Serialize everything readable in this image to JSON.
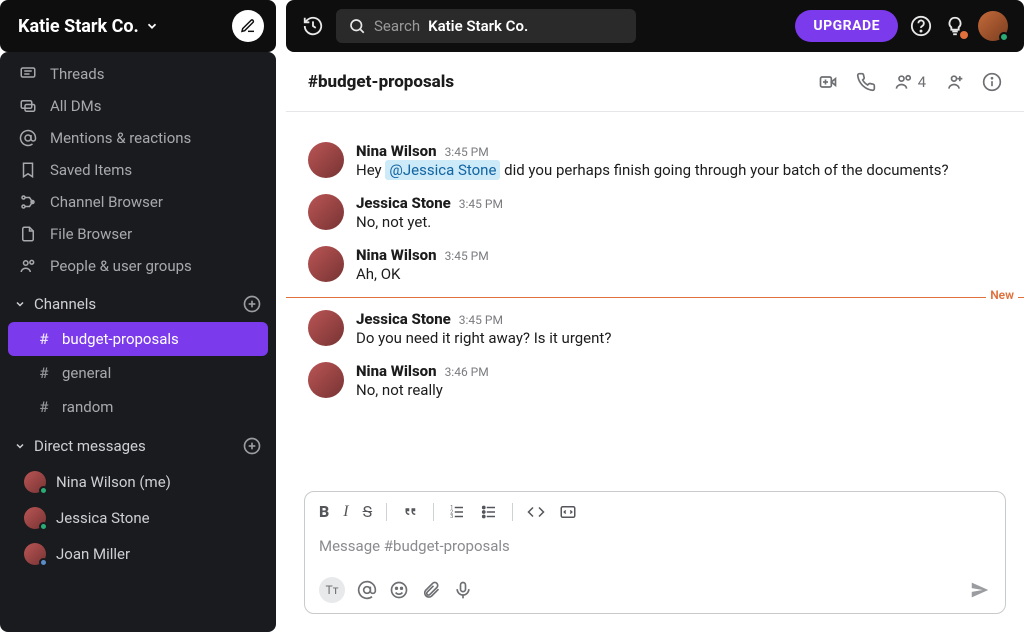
{
  "workspace": {
    "name": "Katie Stark Co."
  },
  "topbar": {
    "search_placeholder": "Search",
    "search_workspace": "Katie Stark Co.",
    "upgrade_label": "UPGRADE"
  },
  "sidebar": {
    "nav": [
      {
        "icon": "threads-icon",
        "label": "Threads"
      },
      {
        "icon": "dms-icon",
        "label": "All DMs"
      },
      {
        "icon": "mentions-icon",
        "label": "Mentions & reactions"
      },
      {
        "icon": "bookmark-icon",
        "label": "Saved Items"
      },
      {
        "icon": "channel-browser-icon",
        "label": "Channel Browser"
      },
      {
        "icon": "file-browser-icon",
        "label": "File Browser"
      },
      {
        "icon": "people-icon",
        "label": "People & user groups"
      }
    ],
    "channels_label": "Channels",
    "channels": [
      {
        "name": "budget-proposals",
        "active": true
      },
      {
        "name": "general",
        "active": false
      },
      {
        "name": "random",
        "active": false
      }
    ],
    "dms_label": "Direct messages",
    "dms": [
      {
        "name": "Nina Wilson (me)",
        "presence": "#2bac76"
      },
      {
        "name": "Jessica Stone",
        "presence": "#2bac76"
      },
      {
        "name": "Joan Miller",
        "presence": "#5a8cc7"
      }
    ]
  },
  "channel": {
    "title": "#budget-proposals",
    "member_count": "4",
    "new_divider_label": "New"
  },
  "messages": [
    {
      "author": "Nina Wilson",
      "time": "3:45 PM",
      "pre": "Hey ",
      "mention": "@Jessica Stone",
      "post": " did you perhaps finish going through your batch of the documents?"
    },
    {
      "author": "Jessica Stone",
      "time": "3:45 PM",
      "text": "No, not yet."
    },
    {
      "author": "Nina Wilson",
      "time": "3:45 PM",
      "text": "Ah, OK"
    },
    {
      "divider": true
    },
    {
      "author": "Jessica Stone",
      "time": "3:45 PM",
      "text": "Do you need it right away? Is it urgent?"
    },
    {
      "author": "Nina Wilson",
      "time": "3:46 PM",
      "text": "No, not really"
    }
  ],
  "composer": {
    "placeholder": "Message #budget-proposals"
  },
  "colors": {
    "accent": "#7c3aed",
    "new_divider": "#e0703c"
  }
}
